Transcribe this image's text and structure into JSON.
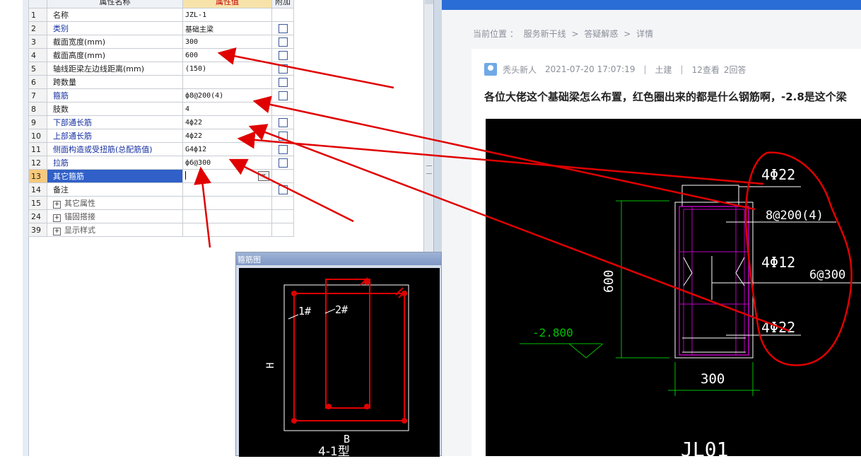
{
  "property_table": {
    "headers": {
      "name": "属性名称",
      "value": "属性值",
      "extra": "附加"
    },
    "rows": [
      {
        "num": "1",
        "name": "名称",
        "value": "JZL-1",
        "checkbox": false,
        "style": "black"
      },
      {
        "num": "2",
        "name": "类别",
        "value": "基础主梁",
        "checkbox": true,
        "style": "blue"
      },
      {
        "num": "3",
        "name": "截面宽度(mm)",
        "value": "300",
        "checkbox": true,
        "style": "black"
      },
      {
        "num": "4",
        "name": "截面高度(mm)",
        "value": "600",
        "checkbox": true,
        "style": "black"
      },
      {
        "num": "5",
        "name": "轴线距梁左边线距离(mm)",
        "value": "(150)",
        "checkbox": true,
        "style": "black"
      },
      {
        "num": "6",
        "name": "跨数量",
        "value": "",
        "checkbox": true,
        "style": "black"
      },
      {
        "num": "7",
        "name": "箍筋",
        "value": "ф8@200(4)",
        "checkbox": true,
        "style": "blue"
      },
      {
        "num": "8",
        "name": "肢数",
        "value": "4",
        "checkbox": false,
        "style": "black"
      },
      {
        "num": "9",
        "name": "下部通长筋",
        "value": "4ф22",
        "checkbox": true,
        "style": "blue"
      },
      {
        "num": "10",
        "name": "上部通长筋",
        "value": "4ф22",
        "checkbox": true,
        "style": "blue"
      },
      {
        "num": "11",
        "name": "侧面构造或受扭筋(总配筋值)",
        "value": "G4ф12",
        "checkbox": true,
        "style": "blue"
      },
      {
        "num": "12",
        "name": "拉筋",
        "value": "ф6@300",
        "checkbox": true,
        "style": "blue"
      },
      {
        "num": "13",
        "name": "其它箍筋",
        "value": "",
        "checkbox": false,
        "style": "selected"
      },
      {
        "num": "14",
        "name": "备注",
        "value": "",
        "checkbox": true,
        "style": "black"
      },
      {
        "num": "15",
        "name": "其它属性",
        "value": "",
        "checkbox": false,
        "style": "group"
      },
      {
        "num": "24",
        "name": "锚固搭接",
        "value": "",
        "checkbox": false,
        "style": "group"
      },
      {
        "num": "39",
        "name": "显示样式",
        "value": "",
        "checkbox": false,
        "style": "group"
      }
    ]
  },
  "stirrup_window": {
    "title": "箍筋图",
    "label_1": "1#",
    "label_2": "2#",
    "label_h": "H",
    "label_b": "B",
    "caption": "4-1型"
  },
  "web": {
    "breadcrumb": [
      "当前位置 ：",
      "服务新干线",
      ">",
      "答疑解惑",
      ">",
      "详情"
    ],
    "author": "秃头新人",
    "date": "2021-07-20 17:07:19",
    "sep": "|",
    "category": "土建",
    "views": "12查看",
    "answers": "2回答",
    "question": "各位大佬这个基础梁怎么布置，红色圈出来的都是什么钢筋啊，-2.8是这个梁"
  },
  "cad": {
    "top_bars": "4Φ22",
    "stirrup": "8@200(4)",
    "side_bars": "4Φ12",
    "tie": "6@300",
    "bottom_bars": "4Φ22",
    "height": "600",
    "width": "300",
    "elevation": "-2.800",
    "bottom_caption": "JL01"
  },
  "colors": {
    "annotation": "#e00000",
    "cad_green": "#00c000",
    "cad_magenta": "#c000c0",
    "link_blue": "#1530a0"
  }
}
